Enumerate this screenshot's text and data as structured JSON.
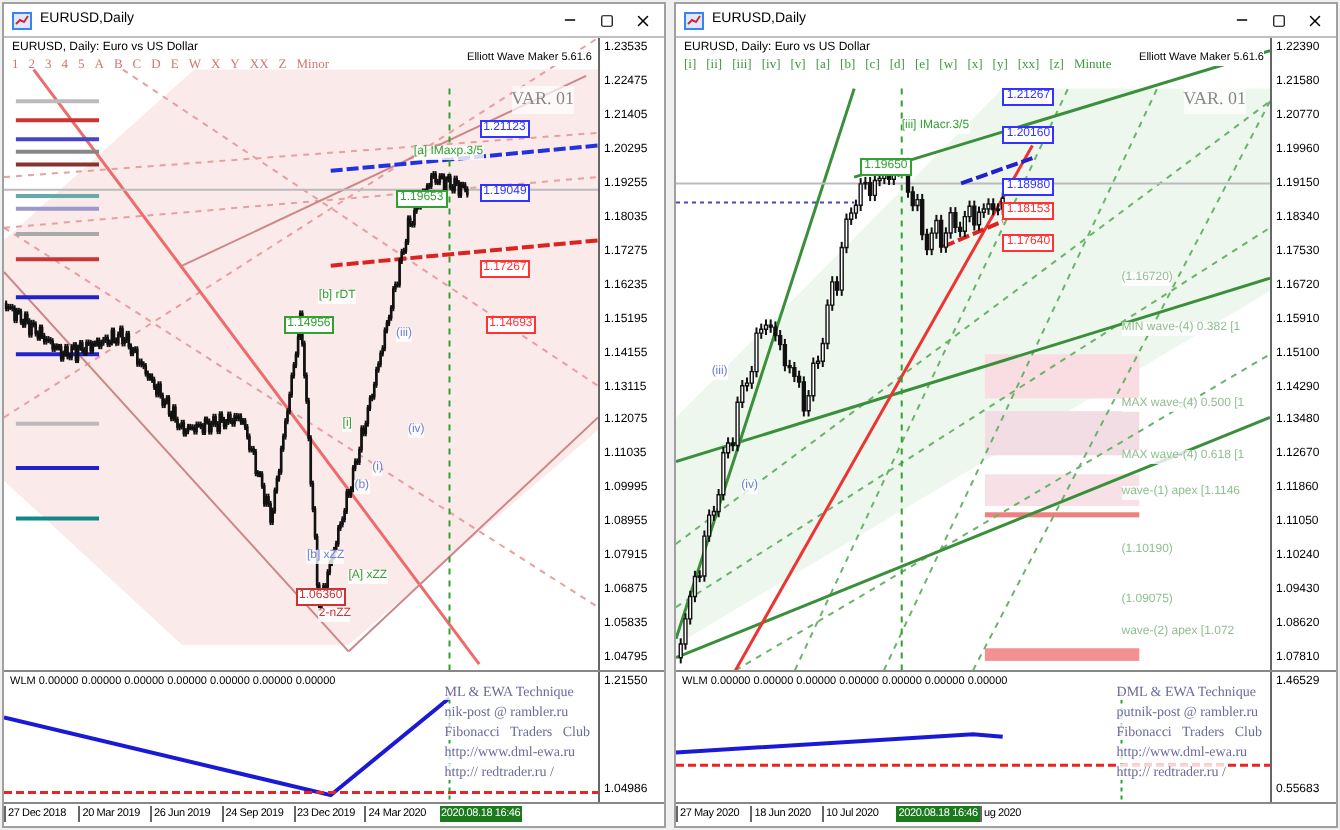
{
  "windows": [
    {
      "title": "EURUSD,Daily",
      "header": "EURUSD, Daily:  Euro vs US Dollar",
      "indicator": "Elliott Wave Maker 5.61.6",
      "variant": "VAR. 01",
      "wave_labels": [
        "1",
        "2",
        "3",
        "4",
        "5",
        "A",
        "B",
        "C",
        "D",
        "E",
        "W",
        "X",
        "Y",
        "XX",
        "Z",
        "Minor"
      ],
      "price_ticks": [
        "1.23535",
        "1.22475",
        "1.21405",
        "1.20295",
        "1.19255",
        "1.18035",
        "1.17275",
        "1.16235",
        "1.15195",
        "1.14155",
        "1.13115",
        "1.12075",
        "1.11035",
        "1.09995",
        "1.08955",
        "1.07915",
        "1.06875",
        "1.05835",
        "1.04795"
      ],
      "price_tags": [
        {
          "text": "1.21123",
          "color": "#3333ff"
        },
        {
          "text": "1.19049",
          "color": "#3333ff"
        },
        {
          "text": "1.19653",
          "color": "#33a033"
        },
        {
          "text": "1.17267",
          "color": "#ff3333"
        },
        {
          "text": "1.14956",
          "color": "#33a033"
        },
        {
          "text": "1.14693",
          "color": "#ff3333"
        },
        {
          "text": "1.06360",
          "color": "#cc3333"
        }
      ],
      "chart_labels": [
        {
          "text": "[a] IMaxp.3/5",
          "color": "#33a033"
        },
        {
          "text": "[b] rDT",
          "color": "#33a033"
        },
        {
          "text": "(iii)",
          "color": "#6b7fd6"
        },
        {
          "text": "(iv)",
          "color": "#6b7fd6"
        },
        {
          "text": "[i]",
          "color": "#33a033"
        },
        {
          "text": "(i)",
          "color": "#6b7fd6"
        },
        {
          "text": "(b)",
          "color": "#6b7fd6"
        },
        {
          "text": "[b] xZZ",
          "color": "#6b7fd6"
        },
        {
          "text": "[A] xZZ",
          "color": "#33a033"
        },
        {
          "text": "2-nZZ",
          "color": "#cc3333"
        }
      ],
      "sub_header": "WLM 0.00000 0.00000 0.00000 0.00000 0.00000 0.00000 0.00000",
      "credits": [
        "ML & EWA Technique",
        "nik-post @ rambler.ru",
        "Fibonacci   Traders   Club",
        "http://www.dml-ewa.ru",
        "http:// redtrader.ru /"
      ],
      "sub_ticks": [
        "1.21550",
        "1.04986"
      ],
      "date_ticks": [
        "27 Dec 2018",
        "20 Mar 2019",
        "26 Jun 2019",
        "24 Sep 2019",
        "23 Dec 2019",
        "24 Mar 2020"
      ],
      "current_date": "2020.08.18 16:46"
    },
    {
      "title": "EURUSD,Daily",
      "header": "EURUSD, Daily:  Euro vs US Dollar",
      "indicator": "Elliott Wave Maker 5.61.6",
      "variant": "VAR. 01",
      "wave_labels": [
        "[i]",
        "[ii]",
        "[iii]",
        "[iv]",
        "[v]",
        "[a]",
        "[b]",
        "[c]",
        "[d]",
        "[e]",
        "[w]",
        "[x]",
        "[y]",
        "[xx]",
        "[z]",
        "Minute"
      ],
      "price_ticks": [
        "1.22390",
        "1.21580",
        "1.20770",
        "1.19960",
        "1.19150",
        "1.18340",
        "1.17530",
        "1.16720",
        "1.15910",
        "1.15100",
        "1.14290",
        "1.13480",
        "1.12670",
        "1.11860",
        "1.11050",
        "1.10240",
        "1.09430",
        "1.08620",
        "1.07810"
      ],
      "price_tags": [
        {
          "text": "1.21267",
          "color": "#3333ff"
        },
        {
          "text": "1.20160",
          "color": "#3333ff"
        },
        {
          "text": "1.19650",
          "color": "#33a033"
        },
        {
          "text": "1.18980",
          "color": "#3333ff"
        },
        {
          "text": "1.18153",
          "color": "#ff3333"
        },
        {
          "text": "1.17640",
          "color": "#ff3333"
        }
      ],
      "chart_labels": [
        {
          "text": "[iii] IMacr.3/5",
          "color": "#33a033"
        },
        {
          "text": "(iii)",
          "color": "#6b7fd6"
        },
        {
          "text": "(iv)",
          "color": "#6b7fd6"
        },
        {
          "text": "(1.16720)",
          "color": "#8fbf8f"
        },
        {
          "text": "MIN wave-(4) 0.382 [1",
          "color": "#8fbf8f"
        },
        {
          "text": "MAX wave-(4) 0.500 [1",
          "color": "#8fbf8f"
        },
        {
          "text": "MAX wave-(4) 0.618 [1",
          "color": "#8fbf8f"
        },
        {
          "text": "wave-(1) apex [1.1146",
          "color": "#8fbf8f"
        },
        {
          "text": "(1.10190)",
          "color": "#8fbf8f"
        },
        {
          "text": "(1.09075)",
          "color": "#8fbf8f"
        },
        {
          "text": "wave-(2) apex [1.072",
          "color": "#8fbf8f"
        }
      ],
      "sub_header": "WLM 0.00000 0.00000 0.00000 0.00000 0.00000 0.00000 0.00000",
      "credits": [
        "DML & EWA Technique",
        "putnik-post @ rambler.ru",
        "Fibonacci   Traders   Club",
        "http://www.dml-ewa.ru",
        "http:// redtrader.ru /"
      ],
      "sub_ticks": [
        "1.46529",
        "0.55683"
      ],
      "date_ticks": [
        "27 May 2020",
        "18 Jun 2020",
        "10 Jul 2020",
        "ug 2020"
      ],
      "current_date": "2020.08.18 16:46"
    }
  ]
}
